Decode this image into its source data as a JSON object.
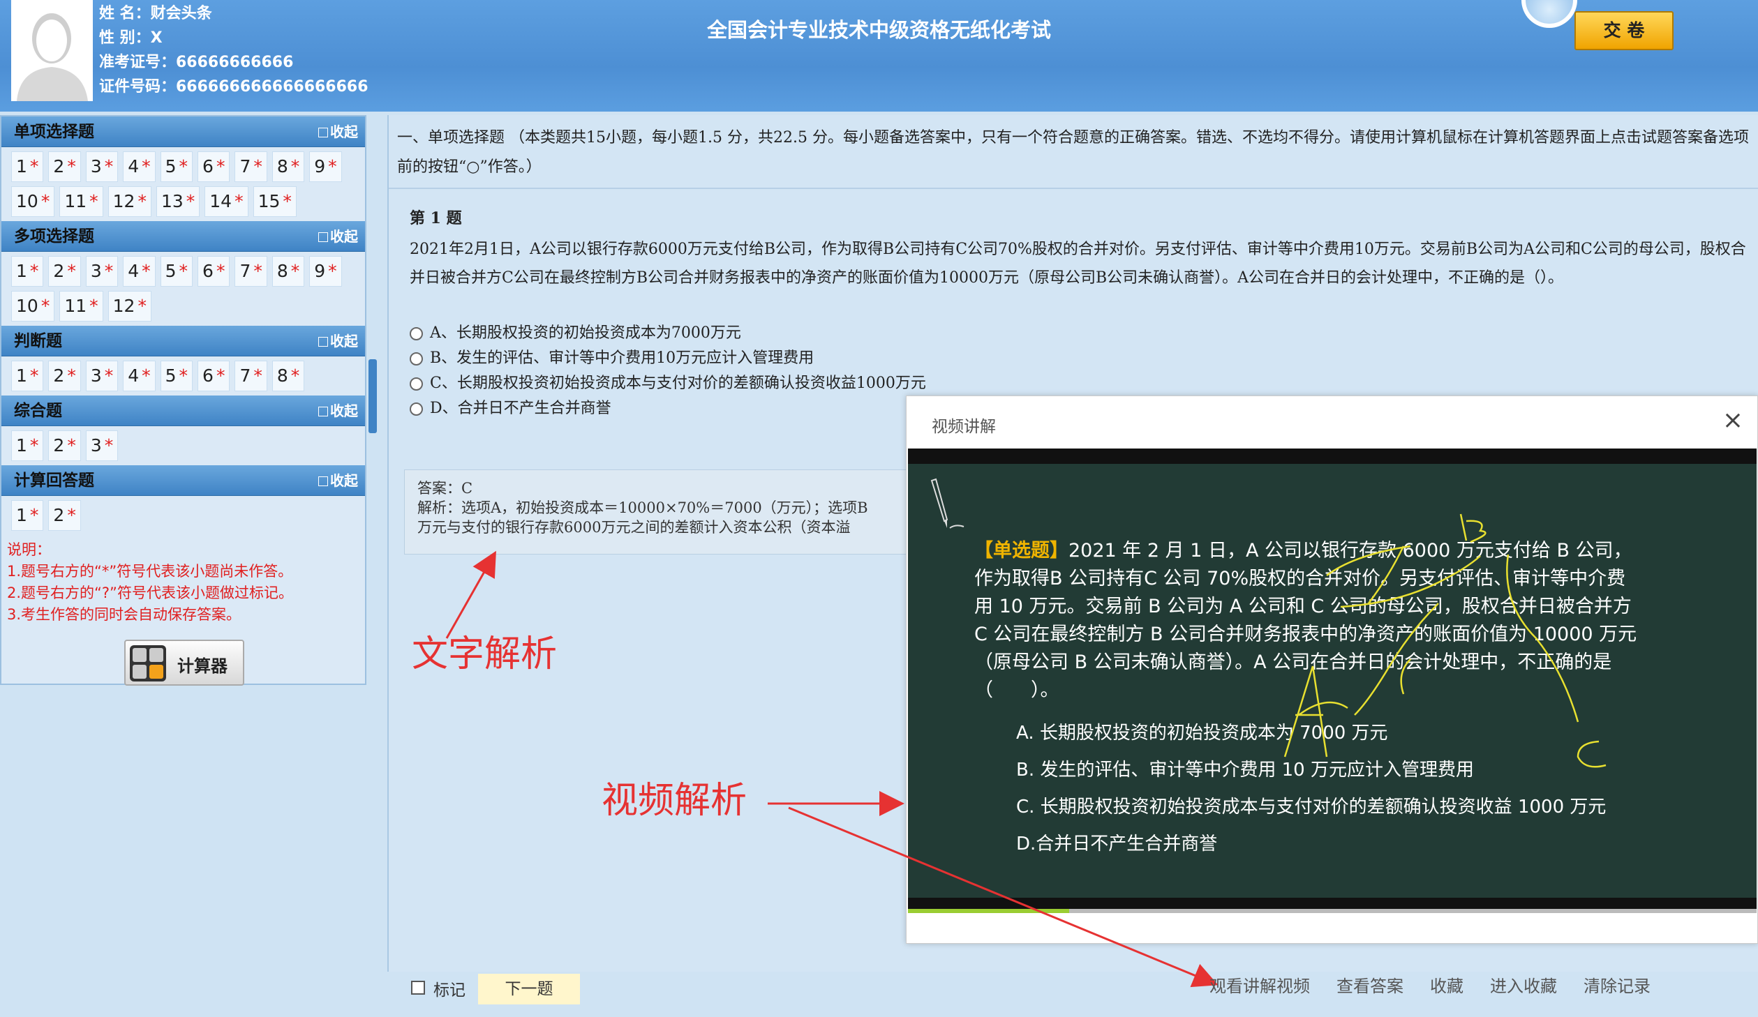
{
  "header": {
    "title": "全国会计专业技术中级资格无纸化考试",
    "submit_label": "交 卷",
    "candidate": {
      "name": "姓 名：财会头条",
      "gender": "性 别：X",
      "ticket": "准考证号：66666666666",
      "id": "证件号码：666666666666666666"
    }
  },
  "sidebar": {
    "collapse_label": "收起",
    "sections": [
      {
        "title": "单项选择题",
        "items": [
          "1",
          "2",
          "3",
          "4",
          "5",
          "6",
          "7",
          "8",
          "9",
          "10",
          "11",
          "12",
          "13",
          "14",
          "15"
        ]
      },
      {
        "title": "多项选择题",
        "items": [
          "1",
          "2",
          "3",
          "4",
          "5",
          "6",
          "7",
          "8",
          "9",
          "10",
          "11",
          "12"
        ]
      },
      {
        "title": "判断题",
        "items": [
          "1",
          "2",
          "3",
          "4",
          "5",
          "6",
          "7",
          "8"
        ]
      },
      {
        "title": "综合题",
        "items": [
          "1",
          "2",
          "3"
        ]
      },
      {
        "title": "计算回答题",
        "items": [
          "1",
          "2"
        ]
      }
    ],
    "star": "*",
    "notes": [
      "说明：",
      "1.题号右方的“*”符号代表该小题尚未作答。",
      "2.题号右方的“?”符号代表该小题做过标记。",
      "3.考生作答的同时会自动保存答案。"
    ],
    "calculator_label": "计算器"
  },
  "main": {
    "instruction": "一、单项选择题 （本类题共15小题，每小题1.5 分，共22.5 分。每小题备选答案中，只有一个符合题意的正确答案。错选、不选均不得分。请使用计算机鼠标在计算机答题界面上点击试题答案备选项前的按钮“○”作答。）",
    "question_number": "第 1 题",
    "question_text": "2021年2月1日，A公司以银行存款6000万元支付给B公司，作为取得B公司持有C公司70%股权的合并对价。另支付评估、审计等中介费用10万元。交易前B公司为A公司和C公司的母公司，股权合并日被合并方C公司在最终控制方B公司合并财务报表中的净资产的账面价值为10000万元（原母公司B公司未确认商誉）。A公司在合并日的会计处理中，不正确的是（）。",
    "options": [
      "A、长期股权投资的初始投资成本为7000万元",
      "B、发生的评估、审计等中介费用10万元应计入管理费用",
      "C、长期股权投资初始投资成本与支付对价的差额确认投资收益1000万元",
      "D、合并日不产生合并商誉"
    ],
    "answer": "答案：C",
    "analysis_line1": "解析：选项A，初始投资成本＝10000×70%＝7000（万元）；选项B",
    "analysis_line2": "万元与支付的银行存款6000万元之间的差额计入资本公积（资本溢"
  },
  "annotations": {
    "text_analysis": "文字解析",
    "video_analysis": "视频解析"
  },
  "video": {
    "title": "视频讲解",
    "close": "×",
    "tag": "【单选题】",
    "board_text": "2021 年 2 月 1 日，A 公司以银行存款 6000 万元支付给 B 公司，作为取得B 公司持有C 公司 70%股权的合并对价。另支付评估、审计等中介费用 10 万元。交易前 B 公司为 A 公司和 C 公司的母公司，股权合并日被合并方 C 公司在最终控制方 B 公司合并财务报表中的净资产的账面价值为 10000 万元（原母公司 B 公司未确认商誉）。A 公司在合并日的会计处理中，不正确的是（　　）。",
    "board_options": [
      "A. 长期股权投资的初始投资成本为 7000 万元",
      "B. 发生的评估、审计等中介费用 10 万元应计入管理费用",
      "C. 长期股权投资初始投资成本与支付对价的差额确认投资收益 1000 万元",
      "D.合并日不产生合并商誉"
    ],
    "progress": 0.19
  },
  "bottom": {
    "mark_label": "标记",
    "next_label": "下一题",
    "actions": [
      "观看讲解视频",
      "查看答案",
      "收藏",
      "进入收藏",
      "清除记录"
    ]
  }
}
